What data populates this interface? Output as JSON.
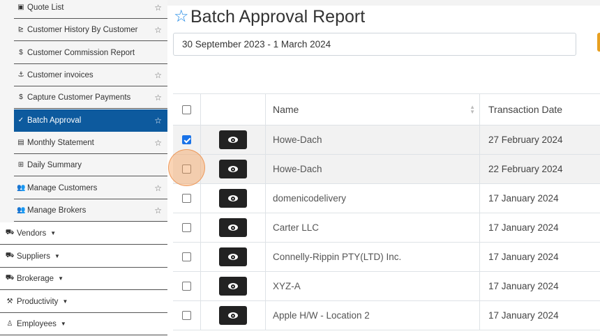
{
  "sidebar": {
    "sub_items": [
      {
        "label": "Quote List",
        "icon": "quote-icon",
        "glyph": "▣",
        "star": true
      },
      {
        "label": "Customer History By Customer",
        "icon": "chart-icon",
        "glyph": "⊵",
        "star": true
      },
      {
        "label": "Customer Commission Report",
        "icon": "dollar-icon",
        "glyph": "$",
        "star": false
      },
      {
        "label": "Customer invoices",
        "icon": "hand-coin-icon",
        "glyph": "⚓",
        "star": true
      },
      {
        "label": "Capture Customer Payments",
        "icon": "dollar-icon",
        "glyph": "$",
        "star": true
      },
      {
        "label": "Batch Approval",
        "icon": "check-icon",
        "glyph": "✓",
        "star": true,
        "active": true
      },
      {
        "label": "Monthly Statement",
        "icon": "list-icon",
        "glyph": "▤",
        "star": true
      },
      {
        "label": "Daily Summary",
        "icon": "table-icon",
        "glyph": "⊞",
        "star": false
      },
      {
        "label": "Manage Customers",
        "icon": "users-icon",
        "glyph": "👥",
        "star": true
      },
      {
        "label": "Manage Brokers",
        "icon": "users-icon",
        "glyph": "👥",
        "star": true
      }
    ],
    "main_items": [
      {
        "label": "Vendors",
        "icon": "truck-icon",
        "glyph": "⛟"
      },
      {
        "label": "Suppliers",
        "icon": "truck-loading-icon",
        "glyph": "⛟"
      },
      {
        "label": "Brokerage",
        "icon": "truck-icon",
        "glyph": "⛟"
      },
      {
        "label": "Productivity",
        "icon": "hammer-icon",
        "glyph": "⚒"
      },
      {
        "label": "Employees",
        "icon": "person-icon",
        "glyph": "♙"
      }
    ]
  },
  "page": {
    "title": "Batch Approval Report",
    "date_range": "30 September 2023 - 1 March 2024"
  },
  "table": {
    "headers": {
      "name": "Name",
      "transaction_date": "Transaction Date"
    },
    "rows": [
      {
        "name": "Howe-Dach",
        "date": "27 February 2024",
        "checked": true,
        "highlighted": true
      },
      {
        "name": "Howe-Dach",
        "date": "22 February 2024",
        "checked": false,
        "highlighted": true
      },
      {
        "name": "domenicodelivery",
        "date": "17 January 2024",
        "checked": false
      },
      {
        "name": "Carter LLC",
        "date": "17 January 2024",
        "checked": false
      },
      {
        "name": "Connelly-Rippin PTY(LTD) Inc.",
        "date": "17 January 2024",
        "checked": false
      },
      {
        "name": "XYZ-A",
        "date": "17 January 2024",
        "checked": false
      },
      {
        "name": "Apple H/W - Location 2",
        "date": "17 January 2024",
        "checked": false
      }
    ]
  },
  "colors": {
    "active_nav": "#0d5a9e",
    "accent_star": "#1e88e5",
    "orange_button": "#e8a020",
    "checkbox_checked": "#1a73e8"
  }
}
